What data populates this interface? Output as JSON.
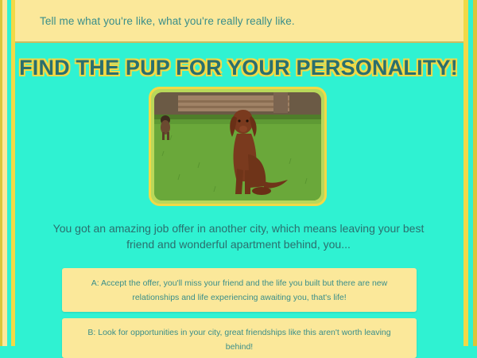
{
  "header": {
    "tagline": "Tell me what you're like, what you're really really like."
  },
  "main": {
    "title": "FIND THE PUP FOR YOUR PERSONALITY!",
    "question": "You got an amazing job offer in another city, which means leaving your best friend and wonderful apartment behind, you...",
    "answers": [
      {
        "label": "A: Accept the offer, you'll miss your friend and the life you built but there are new relationships and life experiencing awaiting you, that's life!"
      },
      {
        "label": "B: Look for opportunities in your city, great friendships like this aren't worth leaving behind!"
      }
    ]
  },
  "colors": {
    "background": "#2ff2d2",
    "header_bg": "#fbe89a",
    "accent_yellow": "#f2d946",
    "text_teal": "#2b6f6e"
  }
}
